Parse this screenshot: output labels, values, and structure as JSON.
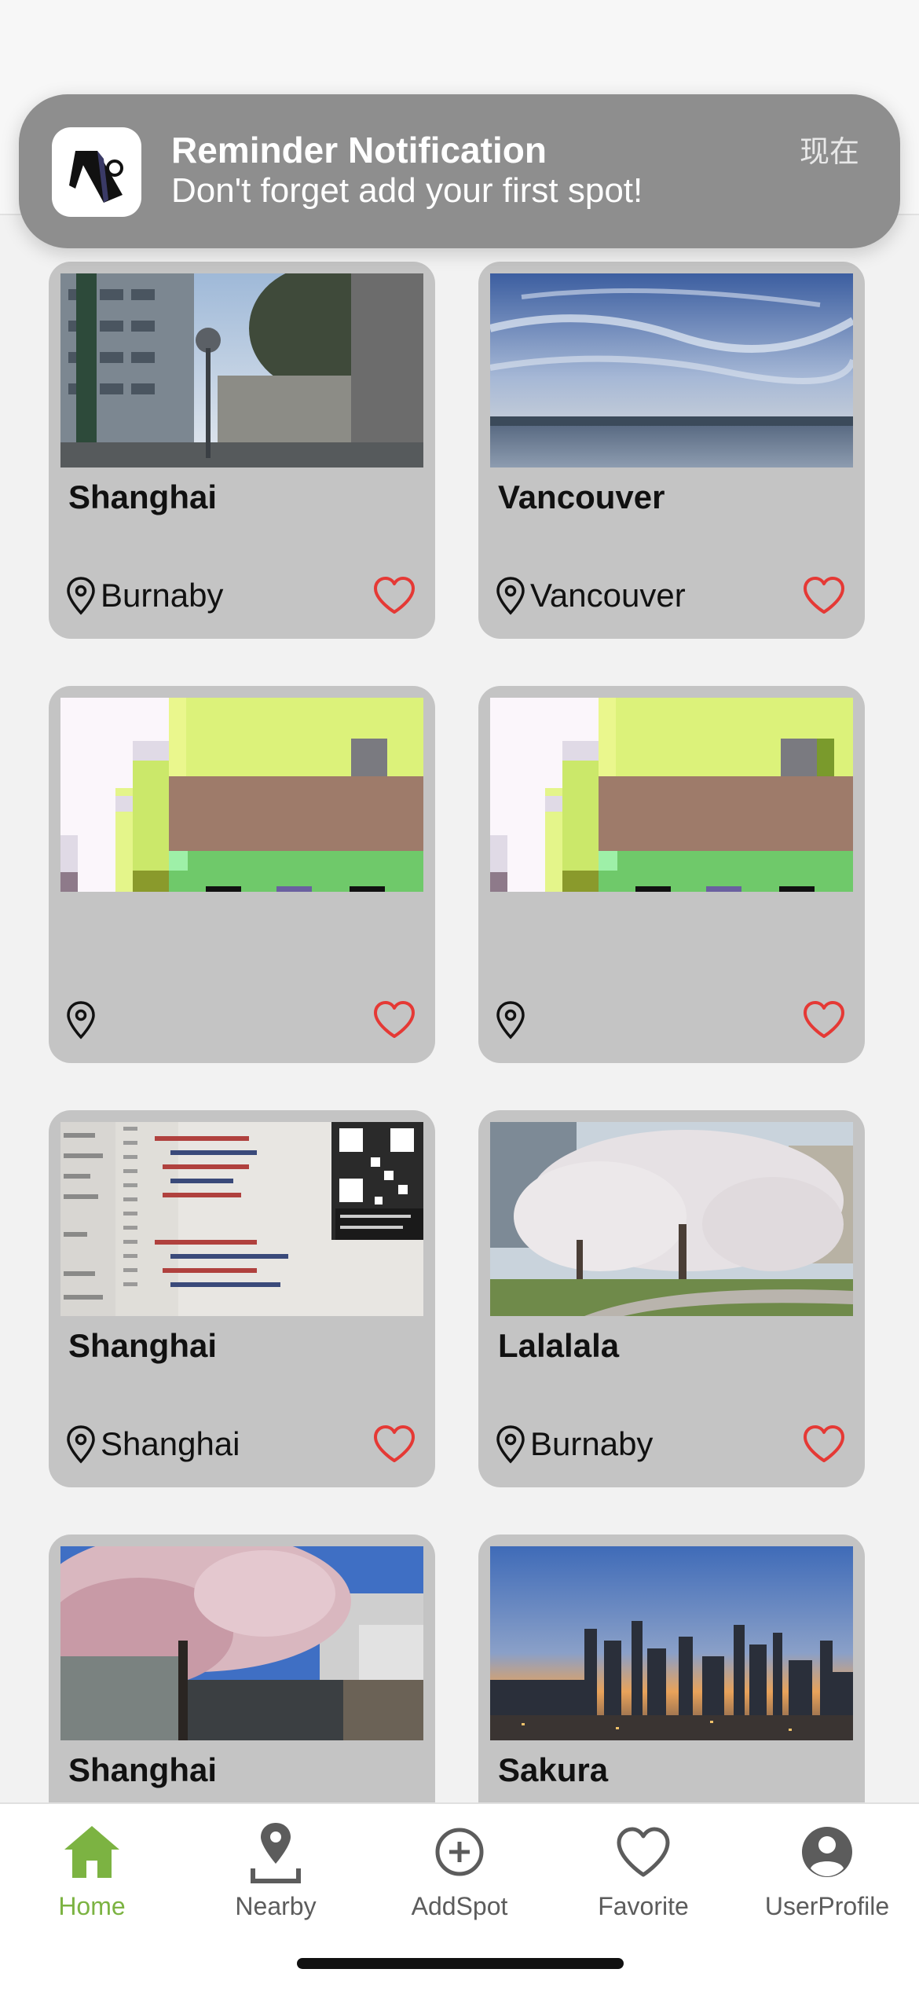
{
  "notification": {
    "title": "Reminder Notification",
    "body": "Don't forget add your first spot!",
    "time": "现在"
  },
  "spots": [
    {
      "title": "Shanghai",
      "location": "Burnaby",
      "image": "street-photo"
    },
    {
      "title": "Vancouver",
      "location": "Vancouver",
      "image": "ocean-sky-photo"
    },
    {
      "title": "",
      "location": "",
      "image": "pixel-placeholder"
    },
    {
      "title": "",
      "location": "",
      "image": "pixel-placeholder"
    },
    {
      "title": "Shanghai",
      "location": "Shanghai",
      "image": "code-screen-photo"
    },
    {
      "title": "Lalalala",
      "location": "Burnaby",
      "image": "cherry-tree-photo"
    },
    {
      "title": "Shanghai",
      "location": "",
      "image": "cherry-blossom-street-photo"
    },
    {
      "title": "Sakura",
      "location": "",
      "image": "city-sunset-photo"
    }
  ],
  "tabs": [
    {
      "label": "Home",
      "icon": "home-icon",
      "active": true
    },
    {
      "label": "Nearby",
      "icon": "map-pin-icon",
      "active": false
    },
    {
      "label": "AddSpot",
      "icon": "plus-circle-icon",
      "active": false
    },
    {
      "label": "Favorite",
      "icon": "heart-icon",
      "active": false
    },
    {
      "label": "UserProfile",
      "icon": "user-circle-icon",
      "active": false
    }
  ],
  "colors": {
    "accent": "#7cb342",
    "heart": "#e53935",
    "card": "#c4c4c4",
    "banner": "#8e8e8e"
  }
}
